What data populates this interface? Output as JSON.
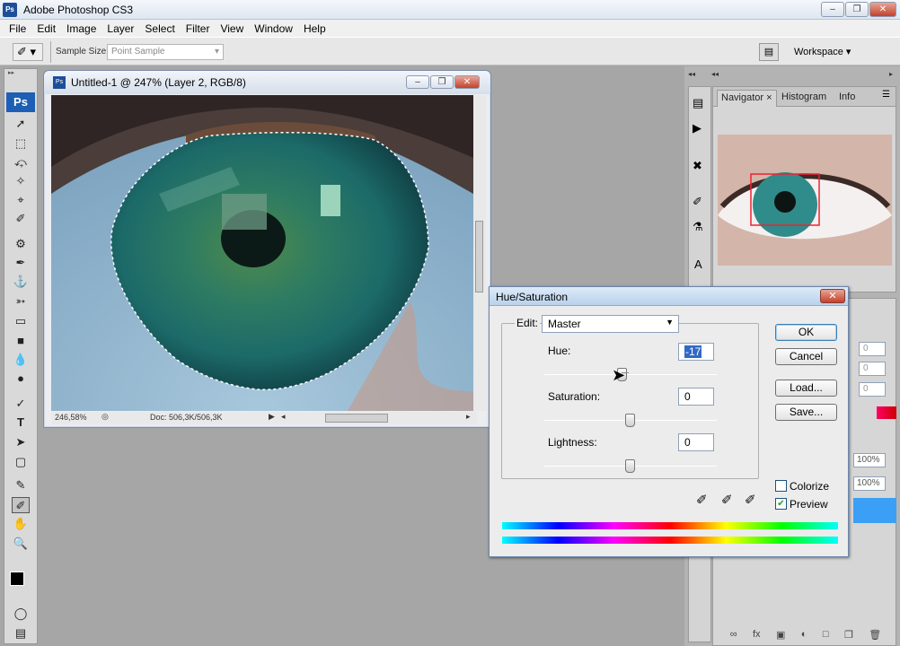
{
  "app": {
    "title": "Adobe Photoshop CS3",
    "logo": "Ps"
  },
  "menu": [
    "File",
    "Edit",
    "Image",
    "Layer",
    "Select",
    "Filter",
    "View",
    "Window",
    "Help"
  ],
  "options": {
    "sample_size_label": "Sample Size:",
    "sample_size_value": "Point Sample",
    "workspace_label": "Workspace ▾"
  },
  "toolbox": {
    "logo": "Ps"
  },
  "document": {
    "title": "Untitled-1 @ 247% (Layer 2, RGB/8)",
    "zoom": "246,58%",
    "doc_info": "Doc: 506,3K/506,3K"
  },
  "panel": {
    "tabs": [
      "Navigator",
      "Histogram",
      "Info"
    ],
    "zoom1": "100%",
    "zoom2": "100%",
    "values": [
      "0",
      "0",
      "0"
    ]
  },
  "dialog": {
    "title": "Hue/Saturation",
    "edit_label": "Edit:",
    "edit_value": "Master",
    "hue_label": "Hue:",
    "hue_value": "-17",
    "hue_level": -17,
    "saturation_label": "Saturation:",
    "saturation_value": "0",
    "lightness_label": "Lightness:",
    "lightness_value": "0",
    "ok": "OK",
    "cancel": "Cancel",
    "load": "Load...",
    "save": "Save...",
    "colorize": "Colorize",
    "preview": "Preview",
    "colorize_checked": false,
    "preview_checked": true
  }
}
